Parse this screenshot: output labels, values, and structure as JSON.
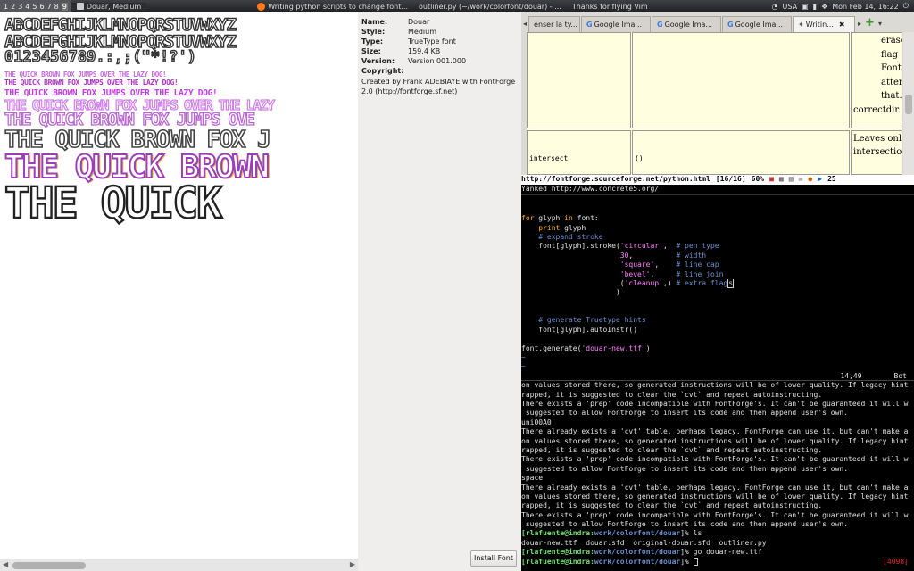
{
  "topbar": {
    "workspaces": [
      "1",
      "2",
      "3",
      "4",
      "5",
      "6",
      "7",
      "8",
      "9"
    ],
    "current_workspace": "9",
    "active_window": "Douar, Medium",
    "windows": [
      "Writing python scripts to change font...",
      "outliner.py (~/work/colorfont/douar) - ...",
      "Thanks for flying Vim"
    ],
    "locale": "USA",
    "clock": "Mon Feb 14, 16:22"
  },
  "preview": {
    "samples": [
      "ABCDEFGHIJKLMNOPQRSTUVWXYZ",
      "ABCDEFGHIJKLMNOPQRSTUVWXYZ",
      "0123456789.:,;(\"*!?')",
      "THE QUICK BROWN FOX JUMPS OVER THE LAZY DOG!",
      "THE QUICK BROWN FOX JUMPS OVER THE LAZY DOG!",
      "THE QUICK BROWN FOX JUMPS OVER THE LAZY DOG!",
      "THE QUICK BROWN FOX JUMPS OVER THE LAZY",
      "THE QUICK BROWN FOX JUMPS OVE",
      "THE QUICK BROWN FOX J",
      "THE QUICK BROWN",
      "THE QUICK"
    ]
  },
  "info": {
    "rows": [
      {
        "k": "Name:",
        "v": "Douar"
      },
      {
        "k": "Style:",
        "v": "Medium"
      },
      {
        "k": "Type:",
        "v": "TrueType font"
      },
      {
        "k": "Size:",
        "v": "159.4 KB"
      },
      {
        "k": "Version:",
        "v": "Version 001.000"
      },
      {
        "k": "Copyright:",
        "v": ""
      }
    ],
    "created": "Created by Frank ADEBIAYE with FontForge 2.0 (http://fontforge.sf.net)",
    "install_label": "Install Font"
  },
  "browser": {
    "tabs": [
      "enser la ty...",
      "Google Ima...",
      "Google Ima...",
      "Google Ima...",
      "Writin..."
    ],
    "cells": {
      "right_text": [
        "erase",
        "flag",
        "Font",
        "atten",
        "that."
      ],
      "correctdir": "correctdir",
      "intersect": "intersect",
      "parens": "()",
      "leaves": [
        "Leaves onl",
        "intersection"
      ]
    }
  },
  "terminal": {
    "status": {
      "url": "http://fontforge.sourceforge.net/python.html",
      "pos": "[16/16]",
      "zoom": "60%",
      "temp": "25"
    },
    "yanked": "Yanked http://www.concrete5.org/",
    "position": "14,49",
    "scroll": "Bot",
    "counter": "[4098]",
    "code": [
      {
        "cls": "",
        "t": ""
      },
      {
        "cls": "",
        "t": ""
      },
      {
        "cls": "kw",
        "t": "for glyph in font:"
      },
      {
        "cls": "kw",
        "t": "    print glyph"
      },
      {
        "cls": "cm",
        "t": "    # expand stroke"
      },
      {
        "cls": "",
        "t": "    font[glyph].stroke('circular',  # pen type"
      },
      {
        "cls": "",
        "t": "                       30,          # width"
      },
      {
        "cls": "",
        "t": "                       'square',    # line cap"
      },
      {
        "cls": "",
        "t": "                       'bevel',     # line join"
      },
      {
        "cls": "",
        "t": "                       ('cleanup',) # extra flags"
      },
      {
        "cls": "",
        "t": "                      )"
      },
      {
        "cls": "",
        "t": ""
      },
      {
        "cls": "",
        "t": ""
      },
      {
        "cls": "cm",
        "t": "    # generate Truetype hints"
      },
      {
        "cls": "",
        "t": "    font[glyph].autoInstr()"
      },
      {
        "cls": "",
        "t": ""
      },
      {
        "cls": "",
        "t": "font.generate('douar-new.ttf')"
      },
      {
        "cls": "tld",
        "t": "~"
      },
      {
        "cls": "tld",
        "t": "~"
      }
    ],
    "output": [
      "on values stored there, so generated instructions will be of lower quality. If legacy hint",
      "rapped, it is suggested to clear the `cvt` and repeat autoinstructing.",
      "There exists a 'prep' code incompatible with FontForge's. It can't be guaranteed it will w",
      " suggested to allow FontForge to insert its code and then append user's own.",
      "uni00A0",
      "There already exists a 'cvt' table, perhaps legacy. FontForge can use it, but can't make a",
      "on values stored there, so generated instructions will be of lower quality. If legacy hint",
      "rapped, it is suggested to clear the `cvt` and repeat autoinstructing.",
      "There exists a 'prep' code incompatible with FontForge's. It can't be guaranteed it will w",
      " suggested to allow FontForge to insert its code and then append user's own.",
      "space",
      "There already exists a 'cvt' table, perhaps legacy. FontForge can use it, but can't make a",
      "on values stored there, so generated instructions will be of lower quality. If legacy hint",
      "rapped, it is suggested to clear the `cvt` and repeat autoinstructing.",
      "There exists a 'prep' code incompatible with FontForge's. It can't be guaranteed it will w",
      " suggested to allow FontForge to insert its code and then append user's own."
    ],
    "prompt1": {
      "user": "[rlafuente@indra:",
      "path": "work/colorfont/douar",
      "rest": "]% ls"
    },
    "ls": "douar-new.ttf  douar.sfd  original-douar.sfd  outliner.py",
    "prompt2": {
      "user": "[rlafuente@indra:",
      "path": "work/colorfont/douar",
      "rest": "]% go douar-new.ttf"
    },
    "prompt3": {
      "user": "[rlafuente@indra:",
      "path": "work/colorfont/douar",
      "rest": "]% "
    }
  },
  "colors": {
    "outline_a": "#e08cf0",
    "outline_b": "#f0c040",
    "outline_c": "#60c060",
    "prompt": "#6ee06e"
  }
}
